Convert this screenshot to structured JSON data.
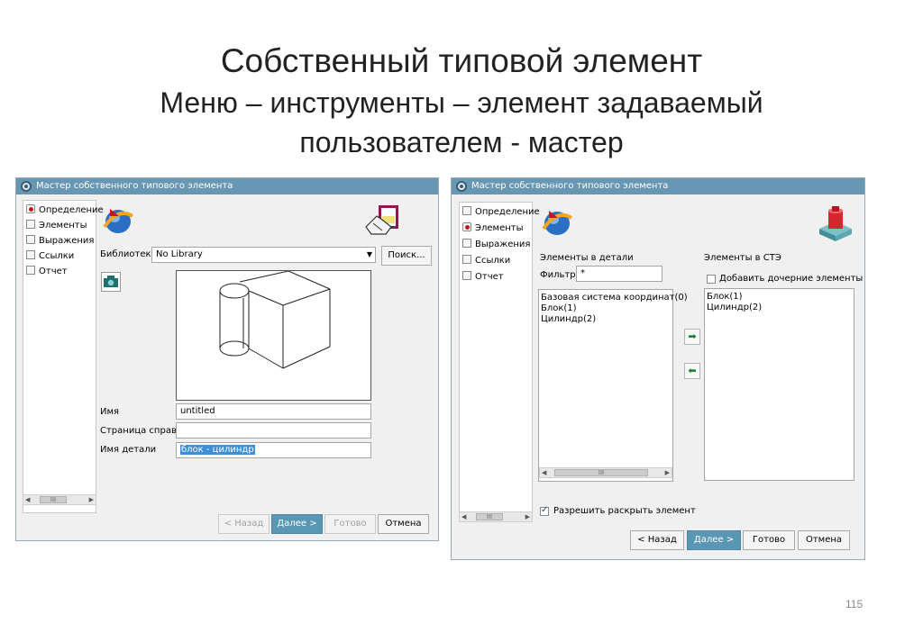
{
  "slide": {
    "title_line1": "Собственный типовой элемент",
    "title_line2": "Меню – инструменты – элемент задаваемый",
    "title_line3": "пользователем - мастер",
    "page_number": "115"
  },
  "dialog1": {
    "title": "Мастер собственного типового элемента",
    "nav": [
      "Определение",
      "Элементы",
      "Выражения",
      "Ссылки",
      "Отчет"
    ],
    "active_nav": 0,
    "library_label": "Библиотека",
    "library_value": "No Library",
    "search_button": "Поиск...",
    "name_label": "Имя",
    "name_value": "untitled",
    "help_page_label": "Страница справки",
    "help_page_value": "",
    "part_name_label": "Имя детали",
    "part_name_value": "блок - цилиндр",
    "buttons": {
      "back": "< Назад",
      "next": "Далее >",
      "finish": "Готово",
      "cancel": "Отмена"
    }
  },
  "dialog2": {
    "title": "Мастер собственного типового элемента",
    "nav": [
      "Определение",
      "Элементы",
      "Выражения",
      "Ссылки",
      "Отчет"
    ],
    "active_nav": 1,
    "part_elements_label": "Элементы в детали",
    "filter_label": "Фильтр",
    "filter_value": "*",
    "part_elements": [
      "Базовая система координат(0)",
      "Блок(1)",
      "Цилиндр(2)"
    ],
    "ste_elements_label": "Элементы в СТЭ",
    "add_children_label": "Добавить дочерние элементы",
    "add_children_checked": false,
    "ste_elements": [
      "Блок(1)",
      "Цилиндр(2)"
    ],
    "allow_expand_label": "Разрешить раскрыть элемент",
    "allow_expand_checked": true,
    "buttons": {
      "back": "< Назад",
      "next": "Далее >",
      "finish": "Готово",
      "cancel": "Отмена"
    }
  },
  "colors": {
    "titlebar": "#6897b3",
    "primary_button": "#5a97b5",
    "selection": "#3f8ed8",
    "active_dot": "#c0181e"
  }
}
